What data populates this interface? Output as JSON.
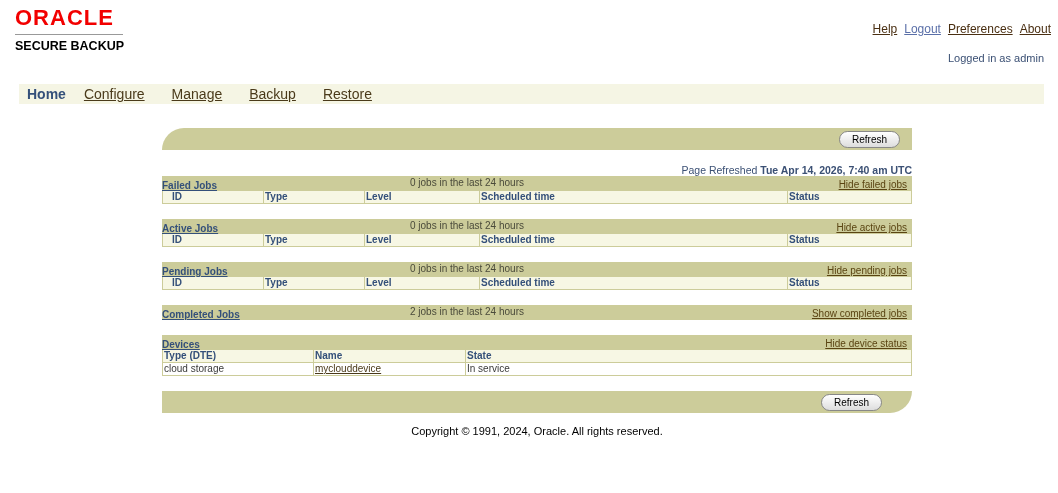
{
  "brand": {
    "logo": "ORACLE",
    "product": "SECURE BACKUP"
  },
  "global_links": [
    {
      "label": "Help",
      "visited": true
    },
    {
      "label": "Logout",
      "visited": false
    },
    {
      "label": "Preferences",
      "visited": true
    },
    {
      "label": "About",
      "visited": true
    }
  ],
  "user_status": "Logged in as admin",
  "tabs": [
    {
      "label": "Home",
      "selected": true
    },
    {
      "label": "Configure",
      "selected": false
    },
    {
      "label": "Manage",
      "selected": false
    },
    {
      "label": "Backup",
      "selected": false
    },
    {
      "label": "Restore",
      "selected": false
    }
  ],
  "top_button": "Refresh",
  "refreshed": {
    "label": "Page Refreshed",
    "time": "Tue Apr 14, 2026, 7:40 am UTC"
  },
  "job_sections": [
    {
      "title": "Failed Jobs",
      "count": "0 jobs in the last 24 hours",
      "toggle": "Hide failed jobs",
      "columns": [
        "ID",
        "Type",
        "Level",
        "Scheduled time",
        "Status"
      ]
    },
    {
      "title": "Active Jobs",
      "count": "0 jobs in the last 24 hours",
      "toggle": "Hide active jobs",
      "columns": [
        "ID",
        "Type",
        "Level",
        "Scheduled time",
        "Status"
      ]
    },
    {
      "title": "Pending Jobs",
      "count": "0 jobs in the last 24 hours",
      "toggle": "Hide pending jobs",
      "columns": [
        "ID",
        "Type",
        "Level",
        "Scheduled time",
        "Status"
      ]
    },
    {
      "title": "Completed Jobs",
      "count": "2 jobs in the last 24 hours",
      "toggle": "Show completed jobs"
    }
  ],
  "devices": {
    "title": "Devices",
    "toggle": "Hide device status",
    "columns": [
      "Type (DTE)",
      "Name",
      "State"
    ],
    "rows": [
      [
        "cloud storage",
        "myclouddevice",
        "In service"
      ]
    ]
  },
  "bottom_button": "Refresh",
  "copyright": "Copyright © 1991, 2024, Oracle. All rights reserved."
}
